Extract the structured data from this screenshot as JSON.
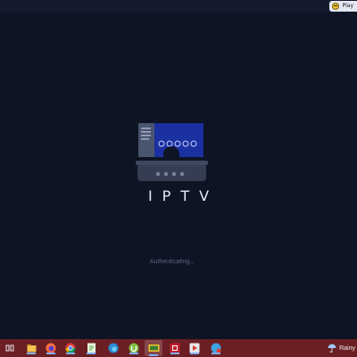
{
  "topbar": {
    "play_label": "Play"
  },
  "app": {
    "title": "IPTV",
    "status": "Authenticating..."
  },
  "colors": {
    "background": "#0f1424",
    "accent_blue": "#1a2fa0",
    "taskbar": "#6b1f24"
  },
  "taskbar": {
    "items": [
      {
        "icon": "task-view-icon"
      },
      {
        "icon": "file-explorer-icon"
      },
      {
        "icon": "firefox-icon"
      },
      {
        "icon": "chrome-icon"
      },
      {
        "icon": "notepad-plus-icon"
      },
      {
        "icon": "edge-icon"
      },
      {
        "icon": "utorrent-icon"
      },
      {
        "icon": "iptv-app-icon",
        "active": true
      },
      {
        "icon": "filezilla-icon"
      },
      {
        "icon": "media-player-icon"
      },
      {
        "icon": "chat-app-icon"
      }
    ],
    "weather_label": "Rainy"
  }
}
